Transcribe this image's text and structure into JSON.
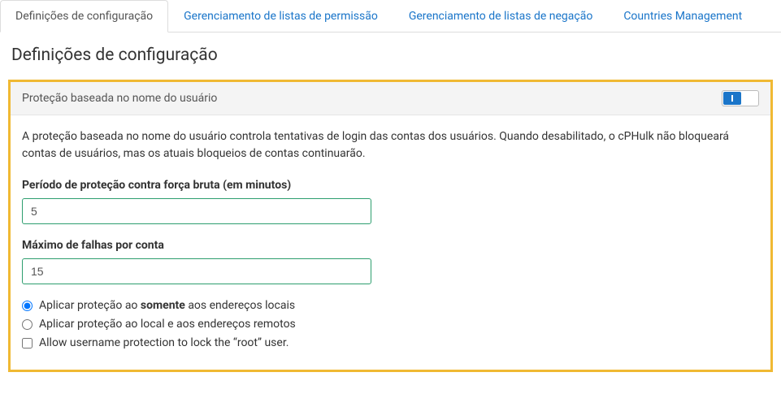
{
  "tabs": {
    "config": "Definições de configuração",
    "whitelist": "Gerenciamento de listas de permissão",
    "blacklist": "Gerenciamento de listas de negação",
    "countries": "Countries Management"
  },
  "page_title": "Definições de configuração",
  "panel": {
    "header_title": "Proteção baseada no nome do usuário",
    "toggle_on": true,
    "description": "A proteção baseada no nome do usuário controla tentativas de login das contas dos usuários. Quando desabilitado, o cPHulk não bloqueará contas de usuários, mas os atuais bloqueios de contas continuarão.",
    "field1_label": "Período de proteção contra força bruta (em minutos)",
    "field1_value": "5",
    "field2_label": "Máximo de falhas por conta",
    "field2_value": "15",
    "radio1_pre": "Aplicar proteção ao ",
    "radio1_bold": "somente",
    "radio1_post": " aos endereços locais",
    "radio2_label": "Aplicar proteção ao local e aos endereços remotos",
    "checkbox_label": "Allow username protection to lock the “root” user."
  }
}
